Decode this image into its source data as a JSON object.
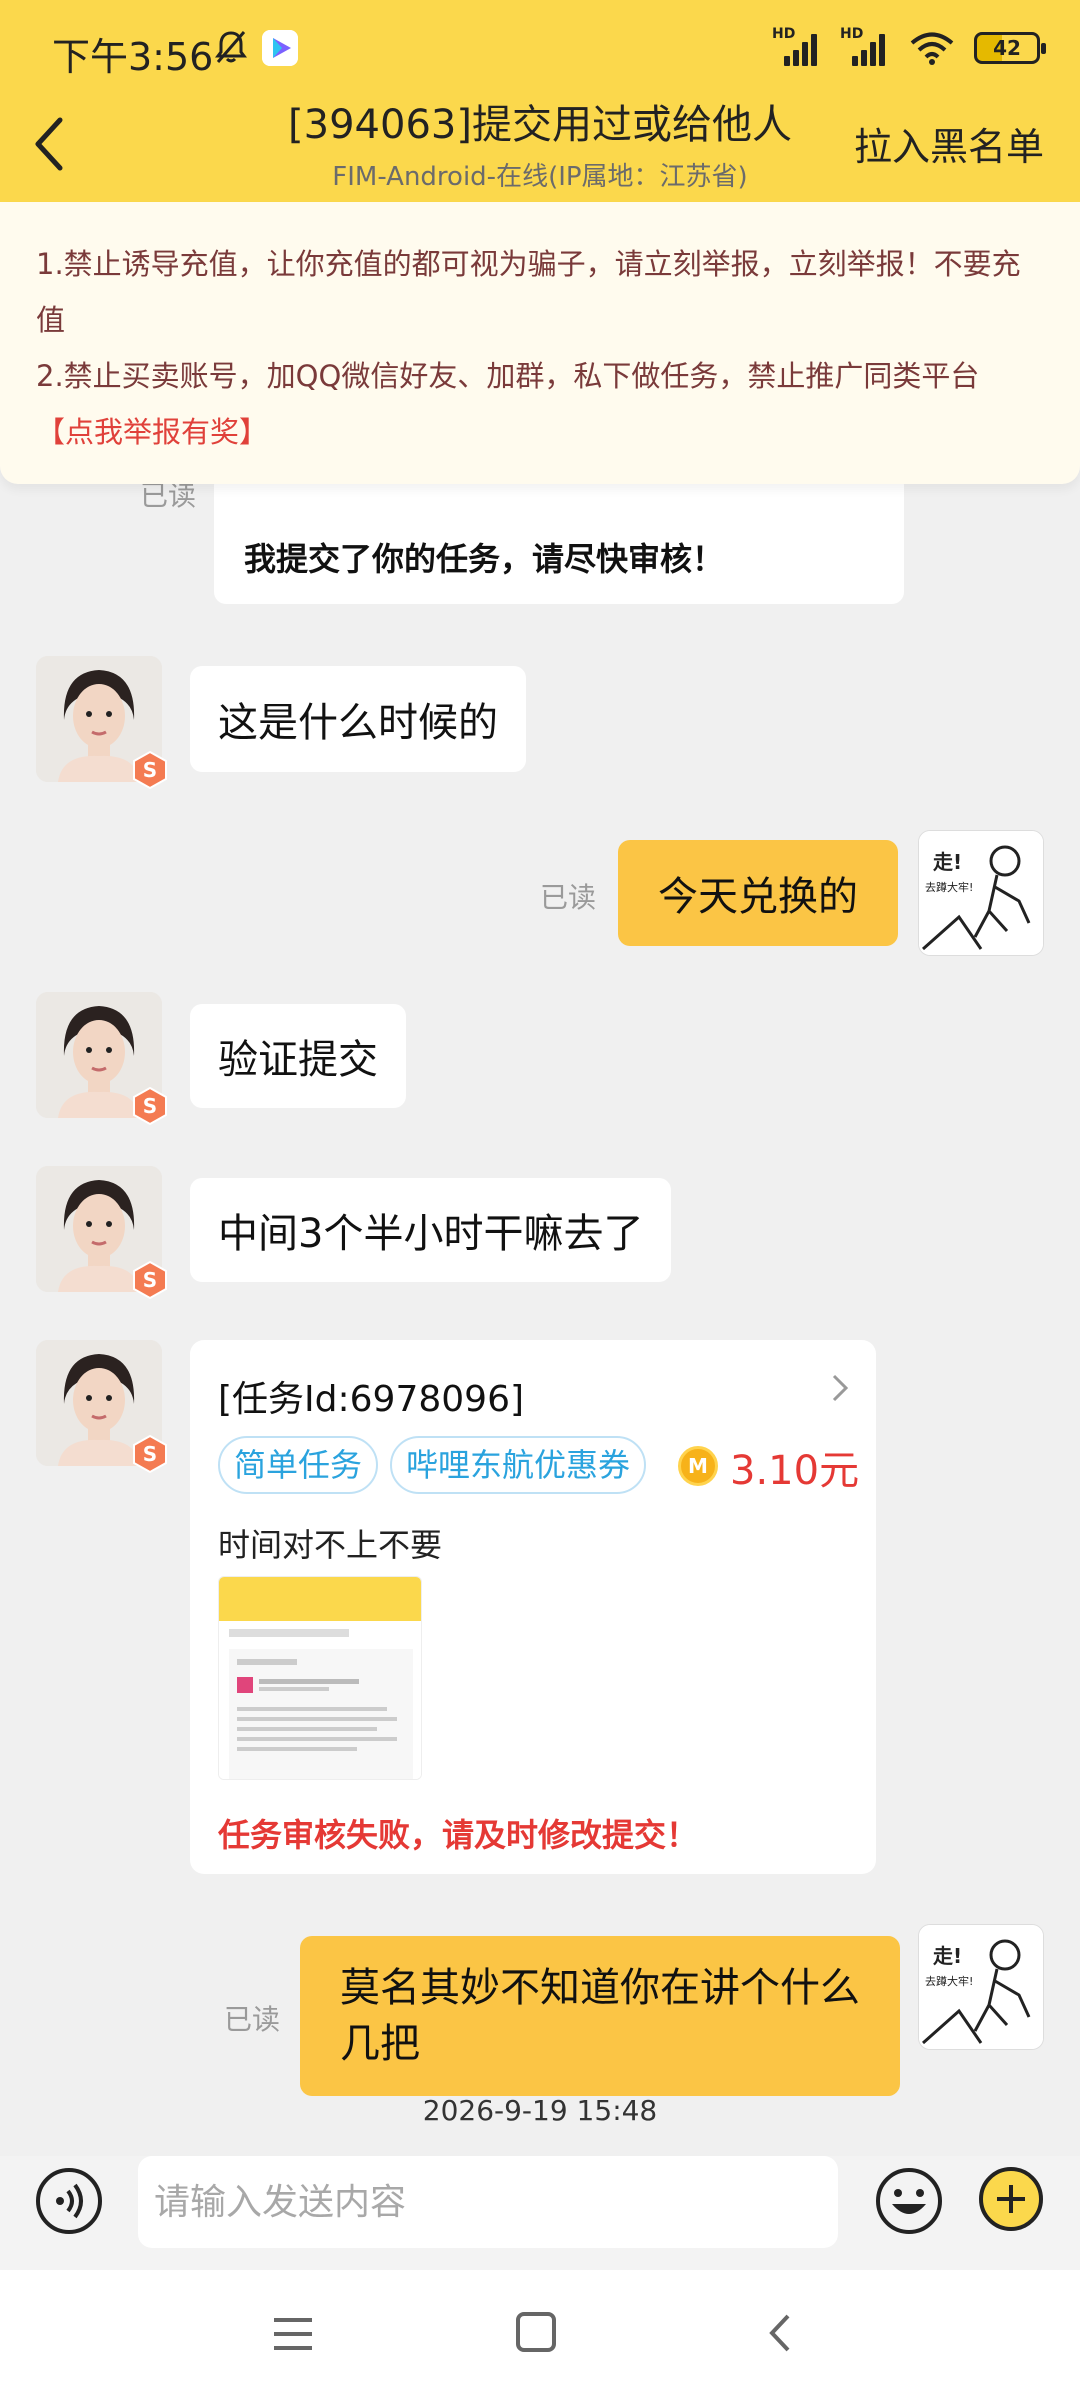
{
  "status_bar": {
    "time": "下午3:56",
    "battery": "42",
    "signal_label": "HD"
  },
  "header": {
    "title": "[394063]提交用过或给他人",
    "subtitle": "FIM-Android-在线(IP属地：江苏省)",
    "blacklist_label": "拉入黑名单"
  },
  "notice": {
    "line1": "1.禁止诱导充值，让你充值的都可视为骗子，请立刻举报，立刻举报！不要充值",
    "line2": "2.禁止买卖账号，加QQ微信好友、加群，私下做任务，禁止推广同类平台",
    "report_link": "【点我举报有奖】"
  },
  "messages": {
    "top_card_text": "我提交了你的任务，请尽快审核！",
    "top_card_read": "已读",
    "m1": "这是什么时候的",
    "m2": "今天兑换的",
    "m2_read": "已读",
    "m3": "验证提交",
    "m4": "中间3个半小时干嘛去了",
    "m6": "莫名其妙不知道你在讲个什么几把",
    "m6_read": "已读",
    "sticker_text_1": "走!",
    "sticker_text_2": "去蹲大牢!"
  },
  "task_card": {
    "id_label": "[任务Id:6978096]",
    "tag1": "简单任务",
    "tag2": "哔哩东航优惠券",
    "coin": "M",
    "price": "3.10元",
    "note": "时间对不上不要",
    "fail_text": "任务审核失败，请及时修改提交！"
  },
  "timestamp": "2026-9-19 15:48",
  "input": {
    "placeholder": "请输入发送内容"
  },
  "colors": {
    "header_bg": "#fbd84c",
    "my_bubble": "#fbc545",
    "tag_text": "#2aa3de",
    "price_red": "#e53935",
    "notice_text": "#7a3a3a"
  }
}
